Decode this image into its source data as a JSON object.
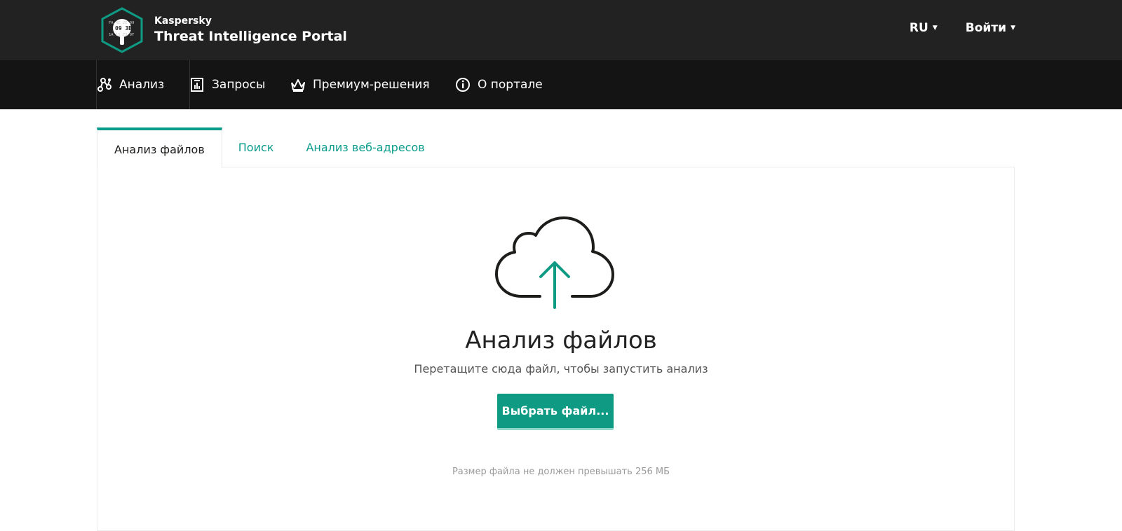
{
  "header": {
    "brand_small": "Kaspersky",
    "brand_big": "Threat Intelligence Portal",
    "logo_text_line1": "FA 4E 2E 09",
    "logo_text_line2": "09 3B",
    "logo_text_line3": "1A 15 F3 9F",
    "language": "RU",
    "login": "Войти"
  },
  "nav": {
    "items": [
      {
        "label": "Анализ",
        "icon": "analysis-icon",
        "active": true
      },
      {
        "label": "Запросы",
        "icon": "requests-icon"
      },
      {
        "label": "Премиум-решения",
        "icon": "crown-icon"
      },
      {
        "label": "О портале",
        "icon": "info-icon"
      }
    ]
  },
  "tabs": [
    {
      "label": "Анализ файлов",
      "active": true
    },
    {
      "label": "Поиск"
    },
    {
      "label": "Анализ веб-адресов"
    }
  ],
  "upload": {
    "icon": "cloud-upload-icon",
    "title": "Анализ файлов",
    "subtitle": "Перетащите сюда файл, чтобы запустить анализ",
    "button_label": "Выбрать файл...",
    "note": "Размер файла не должен превышать 256 МБ"
  },
  "colors": {
    "accent": "#0f9a84",
    "topbar": "#222222",
    "navbar": "#141414"
  }
}
